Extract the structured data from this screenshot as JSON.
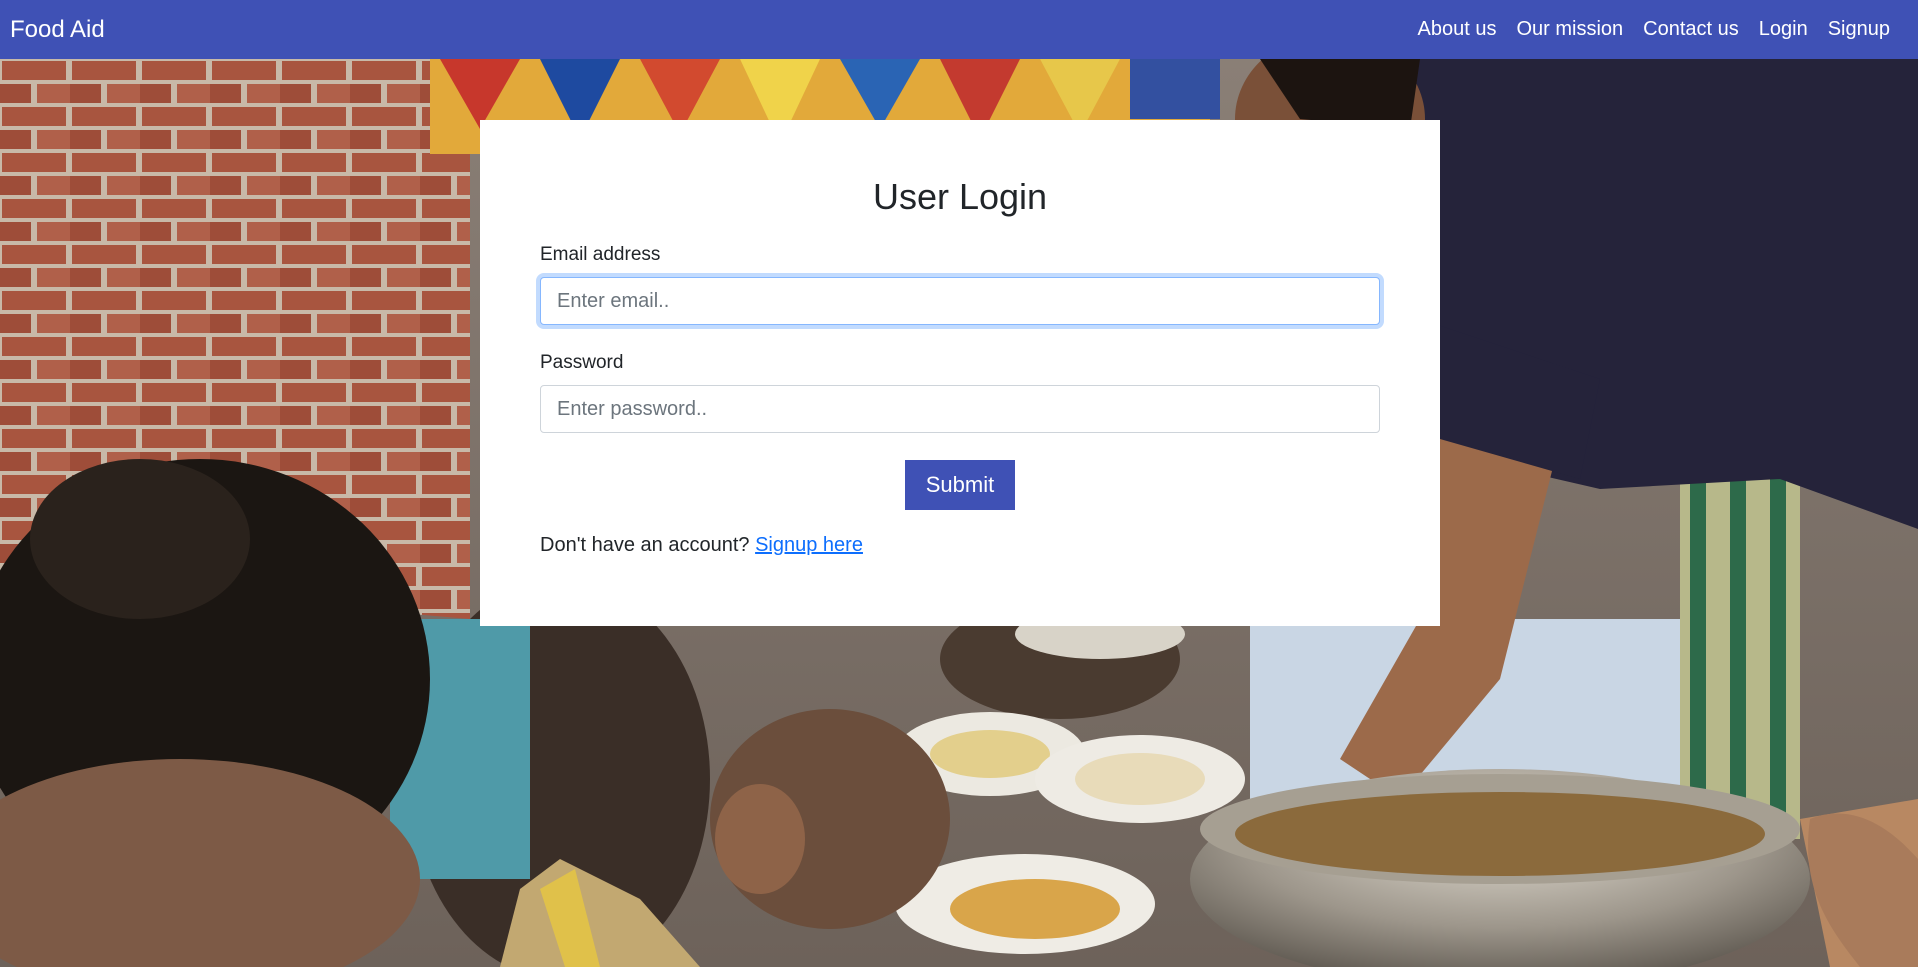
{
  "navbar": {
    "brand": "Food Aid",
    "links": [
      "About us",
      "Our mission",
      "Contact us",
      "Login",
      "Signup"
    ],
    "color": "#3f51b5"
  },
  "login": {
    "title": "User Login",
    "email_label": "Email address",
    "email_placeholder": "Enter email..",
    "email_value": "",
    "password_label": "Password",
    "password_placeholder": "Enter password..",
    "password_value": "",
    "submit_label": "Submit",
    "signup_prompt": "Don't have an account?",
    "signup_link": "Signup here"
  },
  "colors": {
    "accent": "#3f51b5",
    "link": "#0d6efd",
    "focus_ring": "#86b7fe"
  }
}
